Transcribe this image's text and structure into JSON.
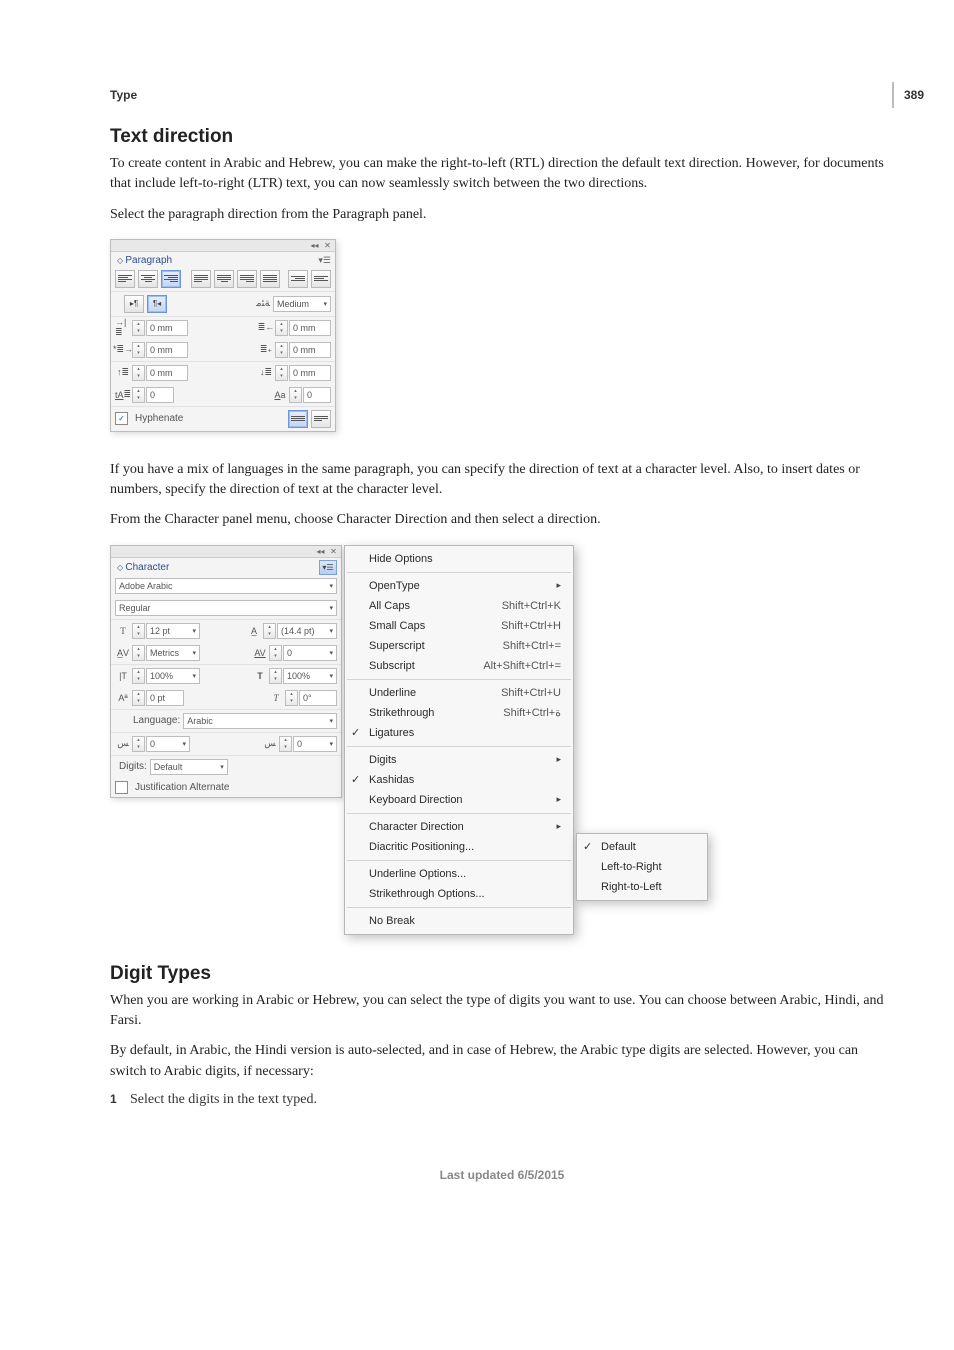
{
  "page_number": "389",
  "breadcrumb": "Type",
  "footer": "Last updated 6/5/2015",
  "text_direction": {
    "heading": "Text direction",
    "p1": "To create content in Arabic and Hebrew, you can make the right-to-left (RTL) direction the default text direction. However, for documents that include left-to-right (LTR) text, you can now seamlessly switch between the two directions.",
    "p2": "Select the paragraph direction from the Paragraph panel.",
    "p3": "If you have a mix of languages in the same paragraph, you can specify the direction of text at a character level. Also, to insert dates or numbers, specify the direction of text at the character level.",
    "p4": "From the Character panel menu, choose Character Direction and then select a direction."
  },
  "paragraph_panel": {
    "tab": "Paragraph",
    "kashida_label": "Medium",
    "indent_left": "0 mm",
    "indent_right": "0 mm",
    "indent_first": "0 mm",
    "indent_last": "0 mm",
    "space_before": "0 mm",
    "space_after": "0 mm",
    "dropcap_lines": "0",
    "dropcap_chars": "0",
    "hyphenate": "Hyphenate"
  },
  "character_panel": {
    "tab": "Character",
    "font_family": "Adobe Arabic",
    "font_style": "Regular",
    "size": "12 pt",
    "leading": "(14.4 pt)",
    "kerning": "Metrics",
    "tracking": "0",
    "hscale": "100%",
    "vscale": "100%",
    "baseline": "0 pt",
    "skew": "0°",
    "language_label": "Language:",
    "language_value": "Arabic",
    "mark_x": "0",
    "mark_y": "0",
    "digits_label": "Digits:",
    "digits_value": "Default",
    "justification_alternate": "Justification Alternate"
  },
  "char_menu": {
    "hide_options": "Hide Options",
    "opentype": "OpenType",
    "all_caps": "All Caps",
    "all_caps_k": "Shift+Ctrl+K",
    "small_caps": "Small Caps",
    "small_caps_k": "Shift+Ctrl+H",
    "superscript": "Superscript",
    "superscript_k": "Shift+Ctrl+=",
    "subscript": "Subscript",
    "subscript_k": "Alt+Shift+Ctrl+=",
    "underline": "Underline",
    "underline_k": "Shift+Ctrl+U",
    "strike": "Strikethrough",
    "strike_k": "Shift+Ctrl+ة",
    "ligatures": "Ligatures",
    "digits": "Digits",
    "kashidas": "Kashidas",
    "keyboard_dir": "Keyboard Direction",
    "char_dir": "Character Direction",
    "diacritic": "Diacritic Positioning...",
    "under_opts": "Underline Options...",
    "strike_opts": "Strikethrough Options...",
    "no_break": "No Break"
  },
  "char_dir_submenu": {
    "default": "Default",
    "ltr": "Left-to-Right",
    "rtl": "Right-to-Left"
  },
  "digit_types": {
    "heading": "Digit Types",
    "p1": "When you are working in Arabic or Hebrew, you can select the type of digits you want to use. You can choose between Arabic, Hindi, and Farsi.",
    "p2": "By default, in Arabic, the Hindi version is auto-selected, and in case of Hebrew, the Arabic type digits are selected. However, you can switch to Arabic digits, if necessary:",
    "step1": "Select the digits in the text typed."
  }
}
